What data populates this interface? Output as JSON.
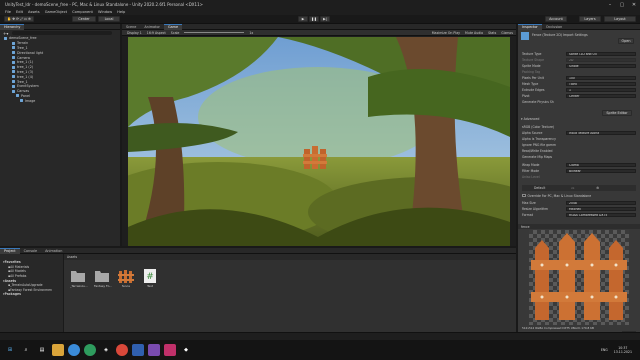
{
  "window": {
    "title": "UnityTest_ldr - demoScene_free - PC, Mac & Linux Standalone - Unity 2020.2.6f1 Personal <DX11>"
  },
  "menu": [
    "File",
    "Edit",
    "Assets",
    "GameObject",
    "Component",
    "Window",
    "Help"
  ],
  "toolbar": {
    "center": "Center",
    "local": "Local",
    "account": "Account",
    "layers": "Layers",
    "layout": "Layout"
  },
  "hierarchy": {
    "tab": "Hierarchy",
    "rows": [
      "demoScene_free",
      "Terrain",
      "Tree_1",
      "Directional light",
      "Camera",
      "tree_1 (1)",
      "tree_1 (2)",
      "tree_1 (3)",
      "tree_1 (4)",
      "Tree_1",
      "EventSystem",
      "Canvas",
      "Panel",
      "Image"
    ]
  },
  "scene": {
    "tabs": [
      "Scene",
      "Animator",
      "Game"
    ],
    "display": "Display 1",
    "aspect": "16:9 Aspect",
    "scale_label": "Scale",
    "scale_value": "1x",
    "options": [
      "Maximize On Play",
      "Mute Audio",
      "Stats",
      "Gizmos"
    ]
  },
  "inspector": {
    "tabs": [
      "Inspector",
      "Occlusion"
    ],
    "header": "Fence (Texture 2D) Import Settings",
    "open": "Open",
    "rows": [
      {
        "label": "Texture Type",
        "value": "Sprite (2D and UI)"
      },
      {
        "label": "Texture Shape",
        "value": "2D",
        "dim": true
      },
      {
        "label": "Sprite Mode",
        "value": "Single"
      },
      {
        "label": "Packing Tag",
        "value": "",
        "dim": true
      },
      {
        "label": "Pixels Per Unit",
        "value": "100"
      },
      {
        "label": "Mesh Type",
        "value": "Tight"
      },
      {
        "label": "Extrude Edges",
        "value": "1"
      },
      {
        "label": "Pivot",
        "value": "Center"
      },
      {
        "label": "Generate Physics Sh",
        "value": ""
      }
    ],
    "sprite_editor": "Sprite Editor",
    "advanced": "Advanced",
    "adv_rows": [
      {
        "label": "sRGB (Color Texture)",
        "value": ""
      },
      {
        "label": "Alpha Source",
        "value": "Input Texture Alpha"
      },
      {
        "label": "Alpha Is Transparency",
        "value": ""
      },
      {
        "label": "Ignore PNG file gamm",
        "value": ""
      },
      {
        "label": "Read/Write Enabled",
        "value": ""
      },
      {
        "label": "Generate Mip Maps",
        "value": ""
      }
    ],
    "wrap_rows": [
      {
        "label": "Wrap Mode",
        "value": "Clamp"
      },
      {
        "label": "Filter Mode",
        "value": "Bilinear"
      },
      {
        "label": "Aniso Level",
        "value": "",
        "dim": true
      }
    ],
    "default_tab": "Default",
    "override_label": "Override For PC, Mac & Linux Standalone",
    "platform_rows": [
      {
        "label": "Max Size",
        "value": "2048"
      },
      {
        "label": "Resize Algorithm",
        "value": "Mitchell"
      },
      {
        "label": "Format",
        "value": "RGBA Compressed DXT5"
      }
    ],
    "preview_title": "fence",
    "preview_info": "512x512  RGBA Compressed DXT5 UNorm  170.8 KB",
    "assetbundle": "AssetBundle",
    "assetbundle_value": "None"
  },
  "project": {
    "tabs": [
      "Project",
      "Console",
      "Animation"
    ],
    "tree": [
      {
        "label": "Favorites",
        "bold": true
      },
      {
        "label": "All Materials"
      },
      {
        "label": "All Models"
      },
      {
        "label": "All Prefabs"
      },
      {
        "label": "Assets",
        "bold": true
      },
      {
        "label": "_TerrainAutoUpgrade"
      },
      {
        "label": "Fantasy Forest Environmen"
      },
      {
        "label": "Packages",
        "bold": true
      }
    ],
    "path": "Assets",
    "assets": [
      {
        "label": "_TerrainAu...",
        "kind": "folder"
      },
      {
        "label": "Fantasy Fo...",
        "kind": "folder"
      },
      {
        "label": "fence",
        "kind": "fence"
      },
      {
        "label": "Test",
        "kind": "script"
      }
    ]
  },
  "taskbar": {
    "time": "10:37",
    "date": "13.11.2021",
    "lang": "ENG"
  }
}
